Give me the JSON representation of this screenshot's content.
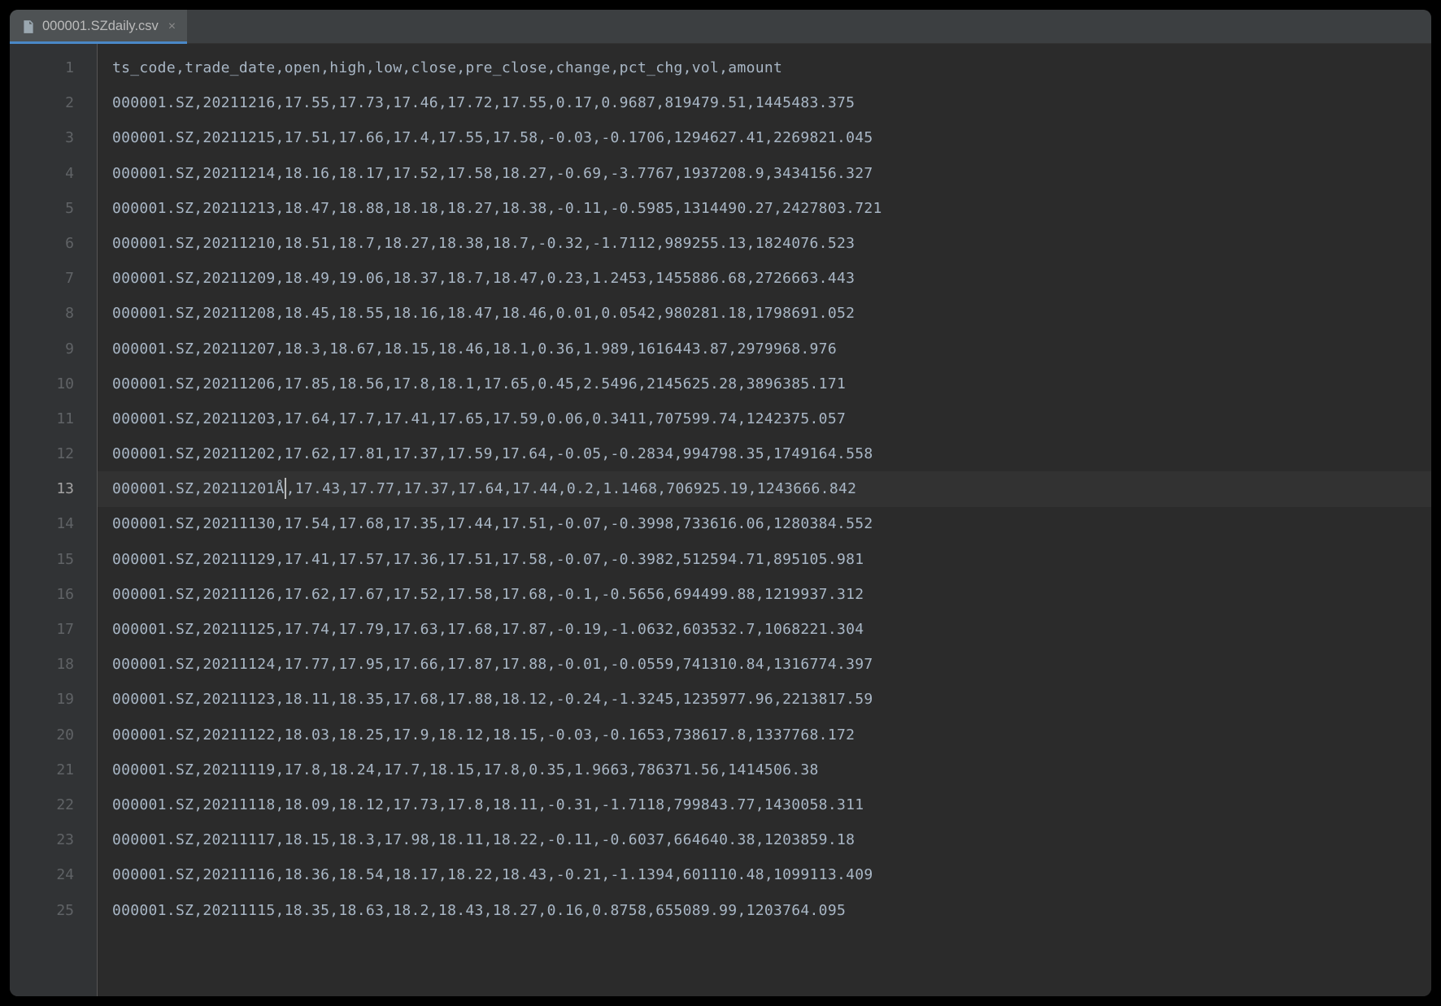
{
  "tab": {
    "filename": "000001.SZdaily.csv"
  },
  "cursor_line": 13,
  "lines": [
    "ts_code,trade_date,open,high,low,close,pre_close,change,pct_chg,vol,amount",
    "000001.SZ,20211216,17.55,17.73,17.46,17.72,17.55,0.17,0.9687,819479.51,1445483.375",
    "000001.SZ,20211215,17.51,17.66,17.4,17.55,17.58,-0.03,-0.1706,1294627.41,2269821.045",
    "000001.SZ,20211214,18.16,18.17,17.52,17.58,18.27,-0.69,-3.7767,1937208.9,3434156.327",
    "000001.SZ,20211213,18.47,18.88,18.18,18.27,18.38,-0.11,-0.5985,1314490.27,2427803.721",
    "000001.SZ,20211210,18.51,18.7,18.27,18.38,18.7,-0.32,-1.7112,989255.13,1824076.523",
    "000001.SZ,20211209,18.49,19.06,18.37,18.7,18.47,0.23,1.2453,1455886.68,2726663.443",
    "000001.SZ,20211208,18.45,18.55,18.16,18.47,18.46,0.01,0.0542,980281.18,1798691.052",
    "000001.SZ,20211207,18.3,18.67,18.15,18.46,18.1,0.36,1.989,1616443.87,2979968.976",
    "000001.SZ,20211206,17.85,18.56,17.8,18.1,17.65,0.45,2.5496,2145625.28,3896385.171",
    "000001.SZ,20211203,17.64,17.7,17.41,17.65,17.59,0.06,0.3411,707599.74,1242375.057",
    "000001.SZ,20211202,17.62,17.81,17.37,17.59,17.64,-0.05,-0.2834,994798.35,1749164.558",
    "000001.SZ,20211201Å,17.43,17.77,17.37,17.64,17.44,0.2,1.1468,706925.19,1243666.842",
    "000001.SZ,20211130,17.54,17.68,17.35,17.44,17.51,-0.07,-0.3998,733616.06,1280384.552",
    "000001.SZ,20211129,17.41,17.57,17.36,17.51,17.58,-0.07,-0.3982,512594.71,895105.981",
    "000001.SZ,20211126,17.62,17.67,17.52,17.58,17.68,-0.1,-0.5656,694499.88,1219937.312",
    "000001.SZ,20211125,17.74,17.79,17.63,17.68,17.87,-0.19,-1.0632,603532.7,1068221.304",
    "000001.SZ,20211124,17.77,17.95,17.66,17.87,17.88,-0.01,-0.0559,741310.84,1316774.397",
    "000001.SZ,20211123,18.11,18.35,17.68,17.88,18.12,-0.24,-1.3245,1235977.96,2213817.59",
    "000001.SZ,20211122,18.03,18.25,17.9,18.12,18.15,-0.03,-0.1653,738617.8,1337768.172",
    "000001.SZ,20211119,17.8,18.24,17.7,18.15,17.8,0.35,1.9663,786371.56,1414506.38",
    "000001.SZ,20211118,18.09,18.12,17.73,17.8,18.11,-0.31,-1.7118,799843.77,1430058.311",
    "000001.SZ,20211117,18.15,18.3,17.98,18.11,18.22,-0.11,-0.6037,664640.38,1203859.18",
    "000001.SZ,20211116,18.36,18.54,18.17,18.22,18.43,-0.21,-1.1394,601110.48,1099113.409",
    "000001.SZ,20211115,18.35,18.63,18.2,18.43,18.27,0.16,0.8758,655089.99,1203764.095"
  ]
}
